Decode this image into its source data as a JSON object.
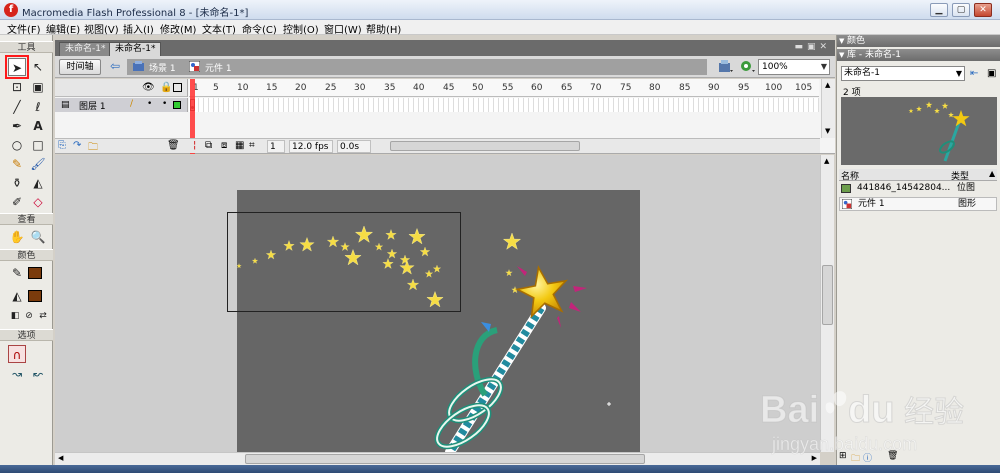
{
  "window": {
    "title": "Macromedia Flash Professional 8 - [未命名-1*]",
    "logo_letter": "f"
  },
  "menu": [
    "文件(F)",
    "编辑(E)",
    "视图(V)",
    "插入(I)",
    "修改(M)",
    "文本(T)",
    "命令(C)",
    "控制(O)",
    "窗口(W)",
    "帮助(H)"
  ],
  "tools": {
    "header": "工具",
    "view_label": "查看",
    "color_label": "颜色",
    "options_label": "选项"
  },
  "document": {
    "tabs": [
      "未命名-1*",
      "未命名-1*"
    ],
    "timeline_button": "时间轴",
    "scene_label": "场景 1",
    "symbol_label": "元件 1",
    "zoom": "100%"
  },
  "timeline": {
    "layer_name": "图层 1",
    "frame_numbers": [
      "1",
      "5",
      "10",
      "15",
      "20",
      "25",
      "30",
      "35",
      "40",
      "45",
      "50",
      "55",
      "60",
      "65",
      "70",
      "75",
      "80",
      "85",
      "90",
      "95",
      "100",
      "105"
    ],
    "current_frame": "1",
    "fps": "12.0 fps",
    "time": "0.0s"
  },
  "panels": {
    "color_title": "颜色",
    "library_title": "库 - 未命名-1",
    "library_select": "未命名-1",
    "item_count": "2 项",
    "col_name": "名称",
    "col_type": "类型",
    "items": [
      {
        "name": "441846_14542804...",
        "type": "位图"
      },
      {
        "name": "元件 1",
        "type": "图形"
      }
    ]
  },
  "watermark": {
    "brand": "Bai",
    "brand2": "du",
    "cn": "经验",
    "url": "jingyan.baidu.com"
  },
  "colors": {
    "stage": "#666666",
    "stroke_swatch": "#000000",
    "fill_swatch": "#7a3b0c",
    "highlight": "#ff1a1a",
    "star_gold": "#f5d20c"
  }
}
